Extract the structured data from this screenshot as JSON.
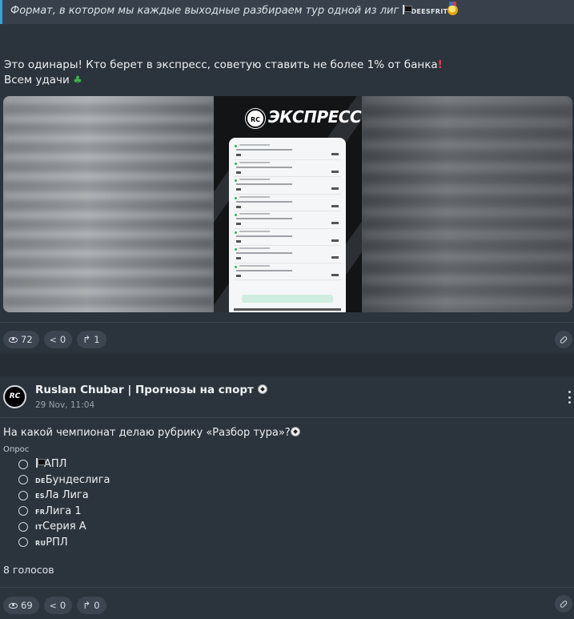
{
  "post1": {
    "quote_text": "Формат, в котором мы каждые выходные разбираем тур одной из лиг",
    "quote_code": "DEESFRIT",
    "message_line1": "Это одинары! Кто берет в экспресс, советую ставить не более 1% от банка",
    "message_line2": "Всем удачи",
    "image_title": "ЭКСПРЕСС",
    "image_logo": "RC",
    "views": "72",
    "shares": "0",
    "replies": "1"
  },
  "post2": {
    "channel_name": "Ruslan Chubar | Прогнозы на спорт",
    "avatar_text": "RC",
    "date": "29 Nov, 11:04",
    "question": "На какой чемпионат делаю рубрику «Разбор тура»?",
    "poll_label": "Опрос",
    "options": [
      {
        "code": "",
        "label": "АПЛ",
        "flag": true
      },
      {
        "code": "DE",
        "label": "Бундеслига",
        "flag": false
      },
      {
        "code": "ES",
        "label": "Ла Лига",
        "flag": false
      },
      {
        "code": "FR",
        "label": "Лига 1",
        "flag": false
      },
      {
        "code": "IT",
        "label": "Серия А",
        "flag": false
      },
      {
        "code": "RU",
        "label": "РПЛ",
        "flag": false
      }
    ],
    "votes": "8 голосов",
    "views": "69",
    "shares": "0",
    "replies": "0"
  },
  "colors": {
    "background": "#2b333c",
    "quote_accent": "#3aa2d6",
    "pill": "#3c4550"
  }
}
